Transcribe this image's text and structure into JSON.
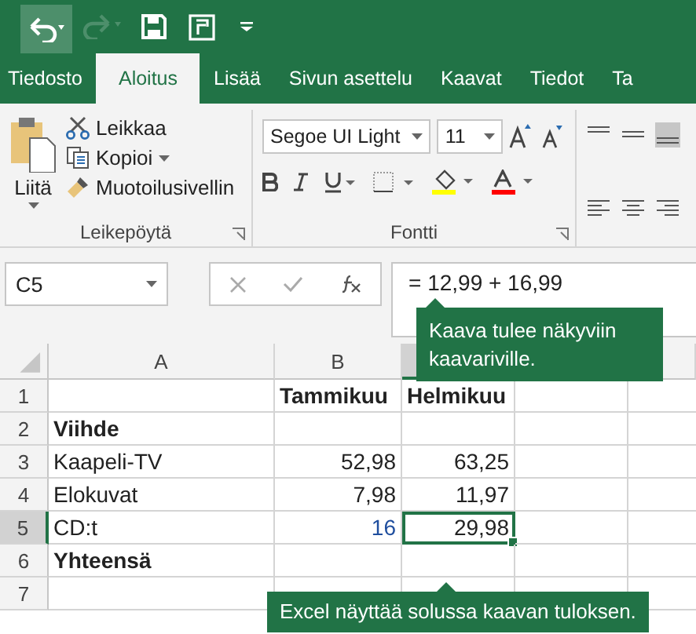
{
  "tabs": [
    {
      "label": "Tiedosto",
      "selected": false
    },
    {
      "label": "Aloitus",
      "selected": true
    },
    {
      "label": "Lisää",
      "selected": false
    },
    {
      "label": "Sivun asettelu",
      "selected": false
    },
    {
      "label": "Kaavat",
      "selected": false
    },
    {
      "label": "Tiedot",
      "selected": false
    },
    {
      "label": "Ta",
      "selected": false
    }
  ],
  "clipboard": {
    "paste": "Liitä",
    "cut": "Leikkaa",
    "copy": "Kopioi",
    "format_painter": "Muotoilusivellin",
    "label": "Leikepöytä"
  },
  "font": {
    "name": "Segoe UI Light",
    "size": "11",
    "label": "Fontti"
  },
  "formula_bar": {
    "name_box": "C5",
    "formula": "= 12,99 + 16,99"
  },
  "callouts": [
    {
      "text": "Kaava tulee näkyviin kaavariville."
    },
    {
      "text": "Excel näyttää solussa kaavan tuloksen."
    }
  ],
  "sheet": {
    "columns": [
      {
        "label": "A",
        "selected": false
      },
      {
        "label": "B",
        "selected": false
      },
      {
        "selected": true
      }
    ],
    "rows": [
      {
        "number": "1",
        "selected": false,
        "bold": true,
        "cells": [
          {},
          {
            "text": "Tammikuu"
          },
          {
            "text": "Helmikuu"
          }
        ]
      },
      {
        "number": "2",
        "selected": false,
        "bold": true,
        "cells": [
          {
            "text": "Viihde"
          },
          {},
          {}
        ]
      },
      {
        "number": "3",
        "selected": false,
        "bold": false,
        "cells": [
          {
            "text": "Kaapeli-TV"
          },
          {
            "text": "52,98",
            "kind": "number"
          },
          {
            "text": "63,25",
            "kind": "number"
          }
        ]
      },
      {
        "number": "4",
        "selected": false,
        "bold": false,
        "cells": [
          {
            "text": "Elokuvat"
          },
          {
            "text": "7,98",
            "kind": "number"
          },
          {
            "text": "11,97",
            "kind": "number"
          }
        ]
      },
      {
        "number": "5",
        "selected": true,
        "bold": false,
        "cells": [
          {
            "text": "CD:t"
          },
          {
            "text": "16",
            "kind": "number",
            "referenced": true
          },
          {
            "text": "29,98",
            "kind": "number",
            "active": true
          }
        ]
      },
      {
        "number": "6",
        "selected": false,
        "bold": true,
        "cells": [
          {
            "text": "Yhteensä"
          },
          {},
          {}
        ]
      },
      {
        "number": "7",
        "selected": false,
        "cells": [
          {},
          {},
          {}
        ]
      }
    ]
  }
}
